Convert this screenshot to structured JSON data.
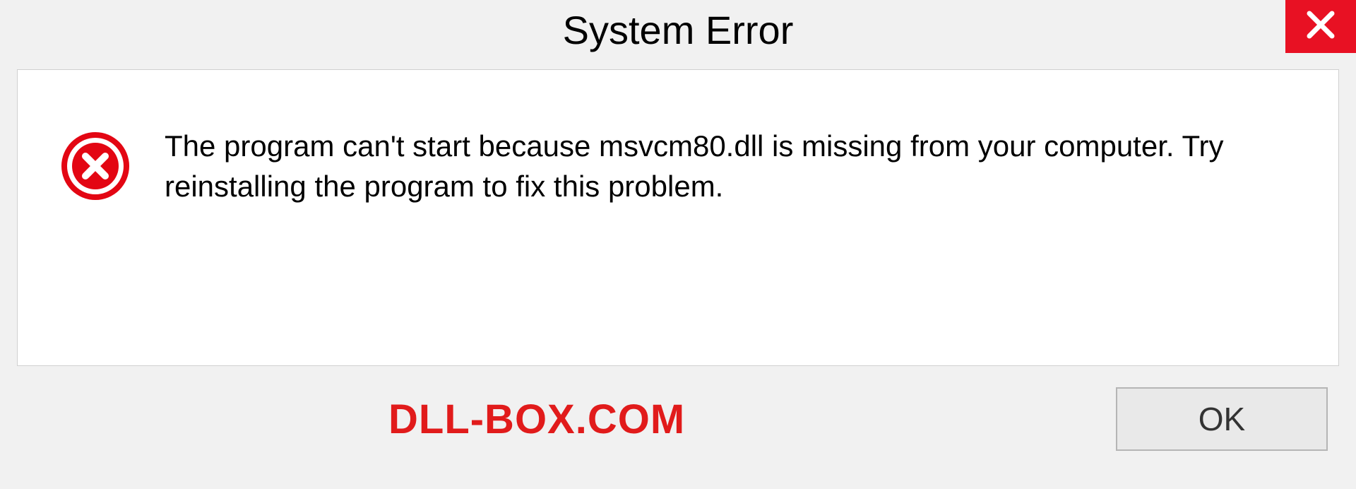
{
  "titlebar": {
    "title": "System Error"
  },
  "message": {
    "text": "The program can't start because msvcm80.dll is missing from your computer. Try reinstalling the program to fix this problem."
  },
  "footer": {
    "brand": "DLL-BOX.COM",
    "ok_label": "OK"
  },
  "colors": {
    "close_bg": "#e81123",
    "error_icon": "#e30613",
    "brand_text": "#e11b1b"
  }
}
